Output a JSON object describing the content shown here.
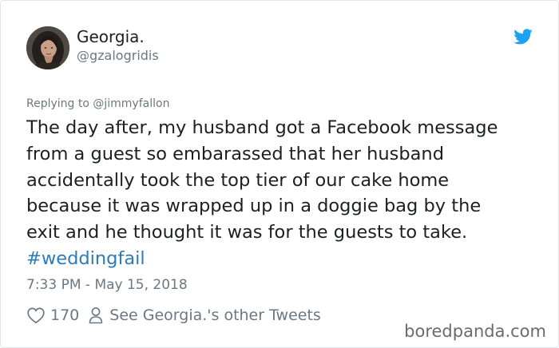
{
  "tweet": {
    "display_name": "Georgia.",
    "handle": "@gzalogridis",
    "replying_to": "Replying to @jimmyfallon",
    "text_lines": [
      "The day after, my husband got a Facebook message",
      "from a guest so embarassed that her husband",
      "accidentally took the top tier of our cake home",
      "because it was wrapped up in a doggie bag by the",
      "exit and he thought it was for the guests to take."
    ],
    "hashtag": "#weddingfail",
    "timestamp": "7:33 PM - May 15, 2018",
    "like_count": "170",
    "other_tweets_link": "See Georgia.'s other Tweets"
  },
  "icons": {
    "brand": "twitter-bird-icon",
    "like": "heart-icon",
    "profile": "person-icon"
  },
  "colors": {
    "twitter_blue": "#1da1f2",
    "link_blue": "#2b7bb9",
    "secondary_text": "#697882",
    "primary_text": "#1c2022"
  },
  "watermark": "boredpanda.com"
}
